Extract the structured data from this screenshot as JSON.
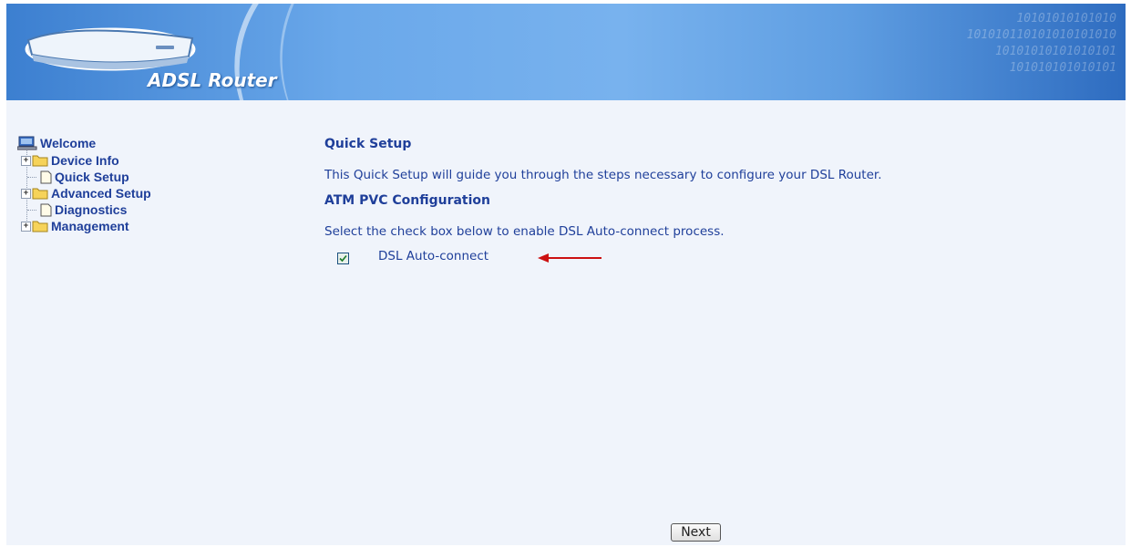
{
  "header": {
    "brand": "ADSL Router",
    "binary_lines": [
      "10101010101010",
      "101010110101010101010",
      "10101010101010101",
      "101010101010101"
    ]
  },
  "nav": {
    "items": [
      {
        "label": "Welcome",
        "icon": "computer-icon",
        "expandable": false
      },
      {
        "label": "Device Info",
        "icon": "folder-icon",
        "expandable": true
      },
      {
        "label": "Quick Setup",
        "icon": "page-icon",
        "expandable": false
      },
      {
        "label": "Advanced Setup",
        "icon": "folder-icon",
        "expandable": true
      },
      {
        "label": "Diagnostics",
        "icon": "page-icon",
        "expandable": false
      },
      {
        "label": "Management",
        "icon": "folder-icon",
        "expandable": true
      }
    ]
  },
  "main": {
    "title": "Quick Setup",
    "intro": "This Quick Setup will guide you through the steps necessary to configure your DSL Router.",
    "section_title": "ATM PVC Configuration",
    "instruction": "Select the check box below to enable DSL Auto-connect process.",
    "checkbox": {
      "label": "DSL Auto-connect",
      "checked": true
    },
    "next_label": "Next"
  },
  "colors": {
    "link_blue": "#1f3f9a",
    "page_bg": "#f0f4fb",
    "arrow_red": "#cc1111",
    "banner_blue": "#6aa8ea"
  }
}
